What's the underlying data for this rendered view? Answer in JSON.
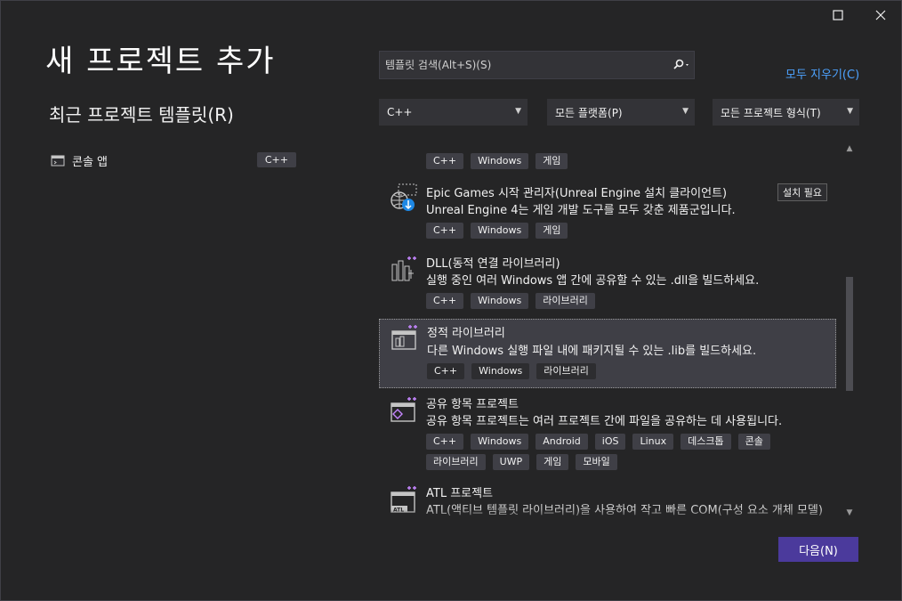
{
  "window": {
    "maximize_icon": "maximize-icon",
    "close_icon": "close-icon"
  },
  "page": {
    "title": "새 프로젝트 추가",
    "recent_title": "최근 프로젝트 템플릿(R)"
  },
  "recent": [
    {
      "label": "콘솔 앱",
      "tag": "C++",
      "icon": "console-app-icon"
    }
  ],
  "search": {
    "placeholder": "템플릿 검색(Alt+S)(S)",
    "icon": "search-icon"
  },
  "clear_all": "모두 지우기(C)",
  "filters": {
    "language": "C++",
    "platform": "모든 플랫폼(P)",
    "project_type": "모든 프로젝트 형식(T)"
  },
  "templates": [
    {
      "title": "",
      "description": "",
      "tags": [
        "C++",
        "Windows",
        "게임"
      ]
    },
    {
      "title": "Epic Games 시작 관리자(Unreal Engine 설치 클라이언트)",
      "description": "Unreal Engine 4는 게임 개발 도구를 모두 갖춘 제품군입니다.",
      "badge": "설치 필요",
      "tags": [
        "C++",
        "Windows",
        "게임"
      ]
    },
    {
      "title": "DLL(동적 연결 라이브러리)",
      "description": "실행 중인 여러 Windows 앱 간에 공유할 수 있는 .dll을 빌드하세요.",
      "tags": [
        "C++",
        "Windows",
        "라이브러리"
      ]
    },
    {
      "title": "정적 라이브러리",
      "description": "다른 Windows 실행 파일 내에 패키지될 수 있는 .lib를 빌드하세요.",
      "tags": [
        "C++",
        "Windows",
        "라이브러리"
      ],
      "selected": true
    },
    {
      "title": "공유 항목 프로젝트",
      "description": "공유 항목 프로젝트는 여러 프로젝트 간에 파일을 공유하는 데 사용됩니다.",
      "tags": [
        "C++",
        "Windows",
        "Android",
        "iOS",
        "Linux",
        "데스크톱",
        "콘솔",
        "라이브러리",
        "UWP",
        "게임",
        "모바일"
      ]
    },
    {
      "title": "ATL 프로젝트",
      "description": "ATL(액티브 템플릿 라이브러리)을 사용하여 작고 빠른 COM(구성 요소 개체 모델)",
      "tags": []
    }
  ],
  "next_button": "다음(N)",
  "colors": {
    "accent": "#4b3a9c",
    "link": "#4da3ff",
    "background": "#252526",
    "selected_bg": "#3f3f46"
  }
}
